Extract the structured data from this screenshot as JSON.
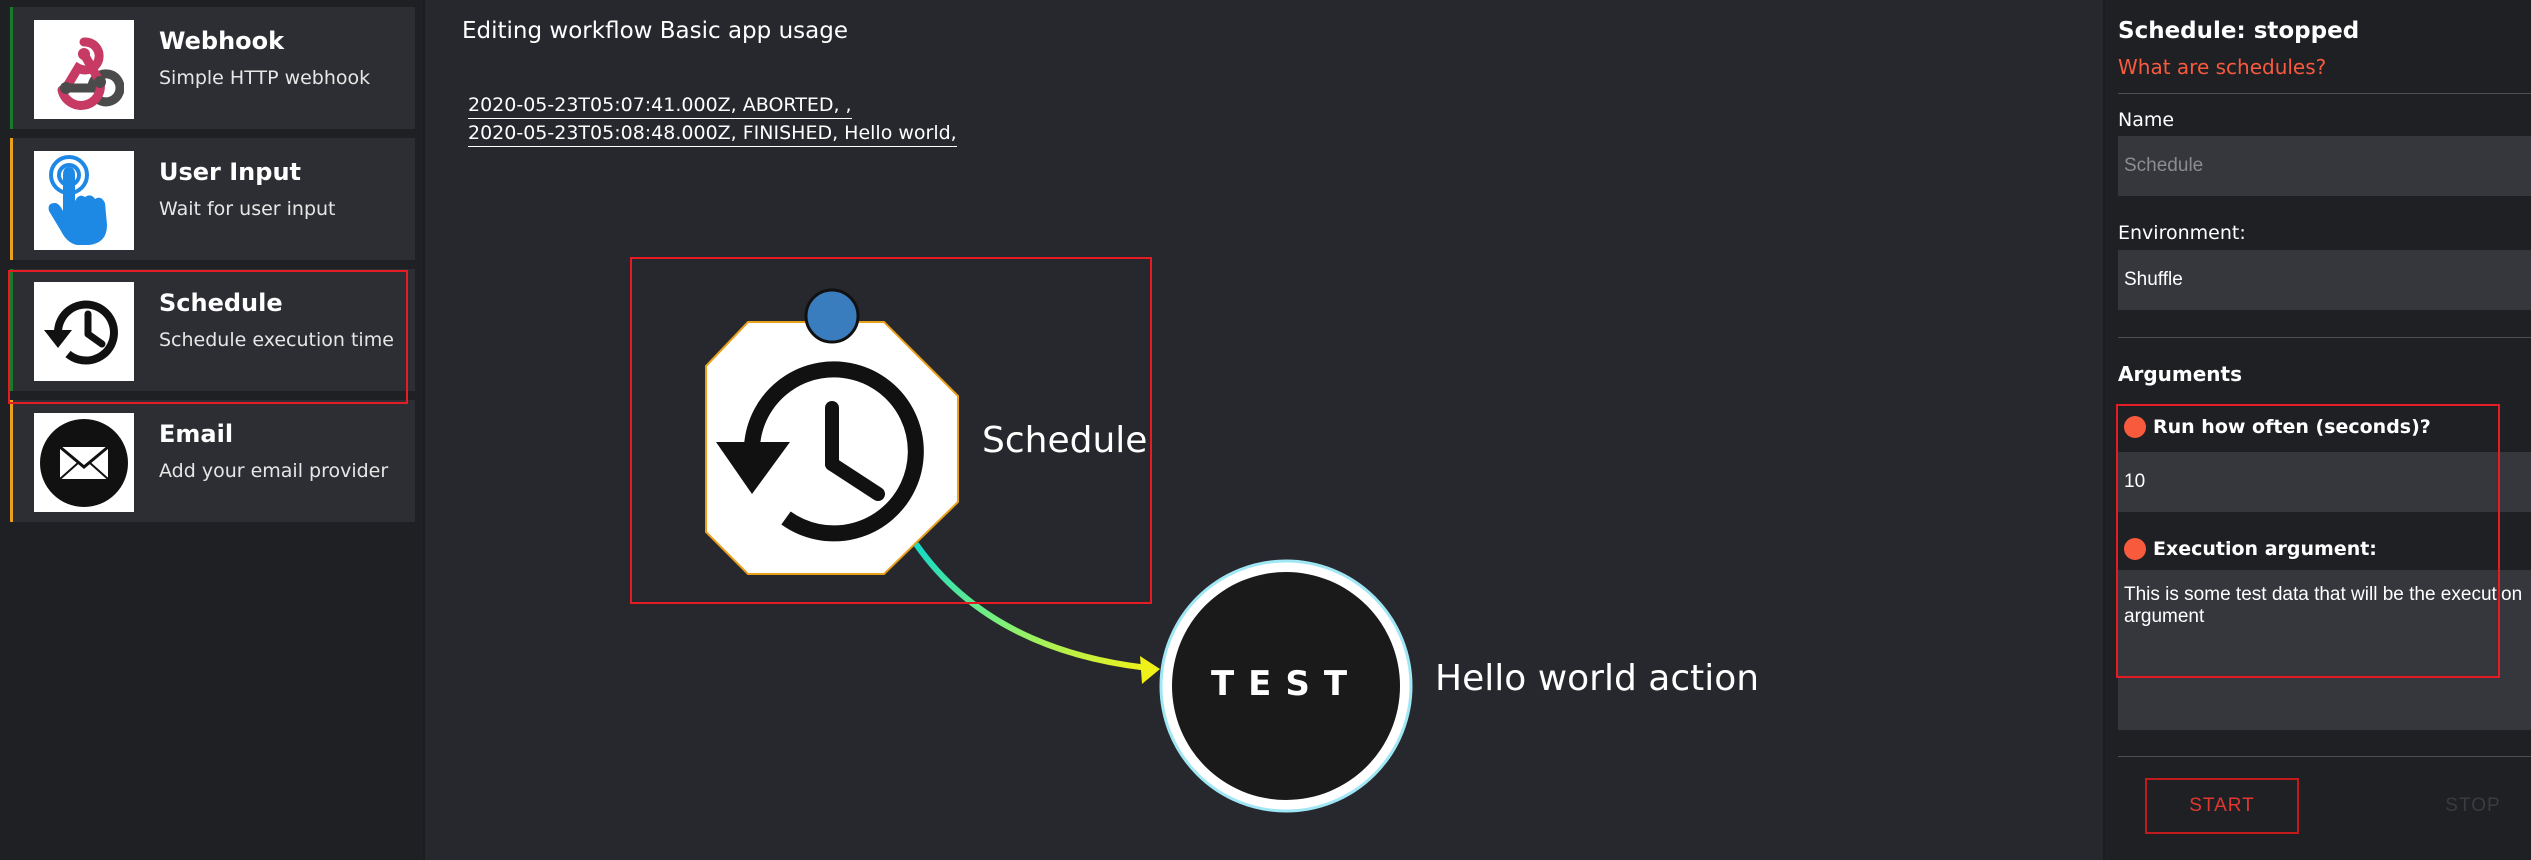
{
  "triggers": [
    {
      "title": "Webhook",
      "description": "Simple HTTP webhook",
      "icon": "webhook-icon",
      "accent": "#1b7a2a"
    },
    {
      "title": "User Input",
      "description": "Wait for user input",
      "icon": "pointing-hand-icon",
      "accent": "#e8a01d"
    },
    {
      "title": "Schedule",
      "description": "Schedule execution time",
      "icon": "history-clock-icon",
      "accent": "#1b7a2a"
    },
    {
      "title": "Email",
      "description": "Add your email provider",
      "icon": "envelope-icon",
      "accent": "#e8a01d"
    }
  ],
  "workflow": {
    "title": "Editing workflow Basic app usage",
    "executions": [
      "2020-05-23T05:07:41.000Z, ABORTED, ,",
      "2020-05-23T05:08:48.000Z, FINISHED, Hello world,"
    ],
    "nodes": {
      "schedule": {
        "label": "Schedule",
        "icon": "history-clock-icon"
      },
      "test": {
        "label": "Hello world action",
        "logo_text": "TEST"
      }
    }
  },
  "panel": {
    "title": "Schedule: stopped",
    "help_link": "What are schedules?",
    "name_label": "Name",
    "name_placeholder": "Schedule",
    "environment_label": "Environment:",
    "environment_value": "Shuffle",
    "arguments_title": "Arguments",
    "arg1_label": "Run how often (seconds)?",
    "arg1_value": "10",
    "arg2_label": "Execution argument:",
    "arg2_value": "This is some test data that will be the execution argument",
    "start_label": "START",
    "stop_label": "STOP"
  },
  "colors": {
    "accent": "#f85a3e",
    "highlight": "#e51c23",
    "background": "#27282d"
  }
}
